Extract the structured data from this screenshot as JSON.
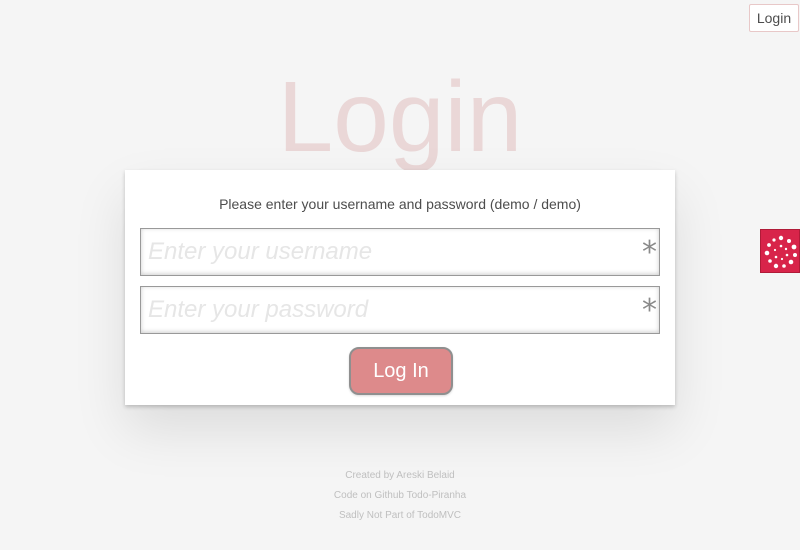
{
  "header": {
    "login_button_label": "Login"
  },
  "page": {
    "title": "Login"
  },
  "form": {
    "instructions": "Please enter your username and password (demo / demo)",
    "username_placeholder": "Enter your username",
    "username_value": "",
    "password_placeholder": "Enter your password",
    "password_value": "",
    "required_marker": "*",
    "submit_label": "Log In"
  },
  "side_widget": {
    "icon": "dots-circle-icon",
    "color": "#d8244a"
  },
  "footer": {
    "lines": [
      "Created by Areski Belaid",
      "Code on Github Todo-Piranha",
      "Sadly Not Part of TodoMVC"
    ]
  },
  "colors": {
    "accent": "#dd8a8b",
    "title": "#af2f2f"
  }
}
